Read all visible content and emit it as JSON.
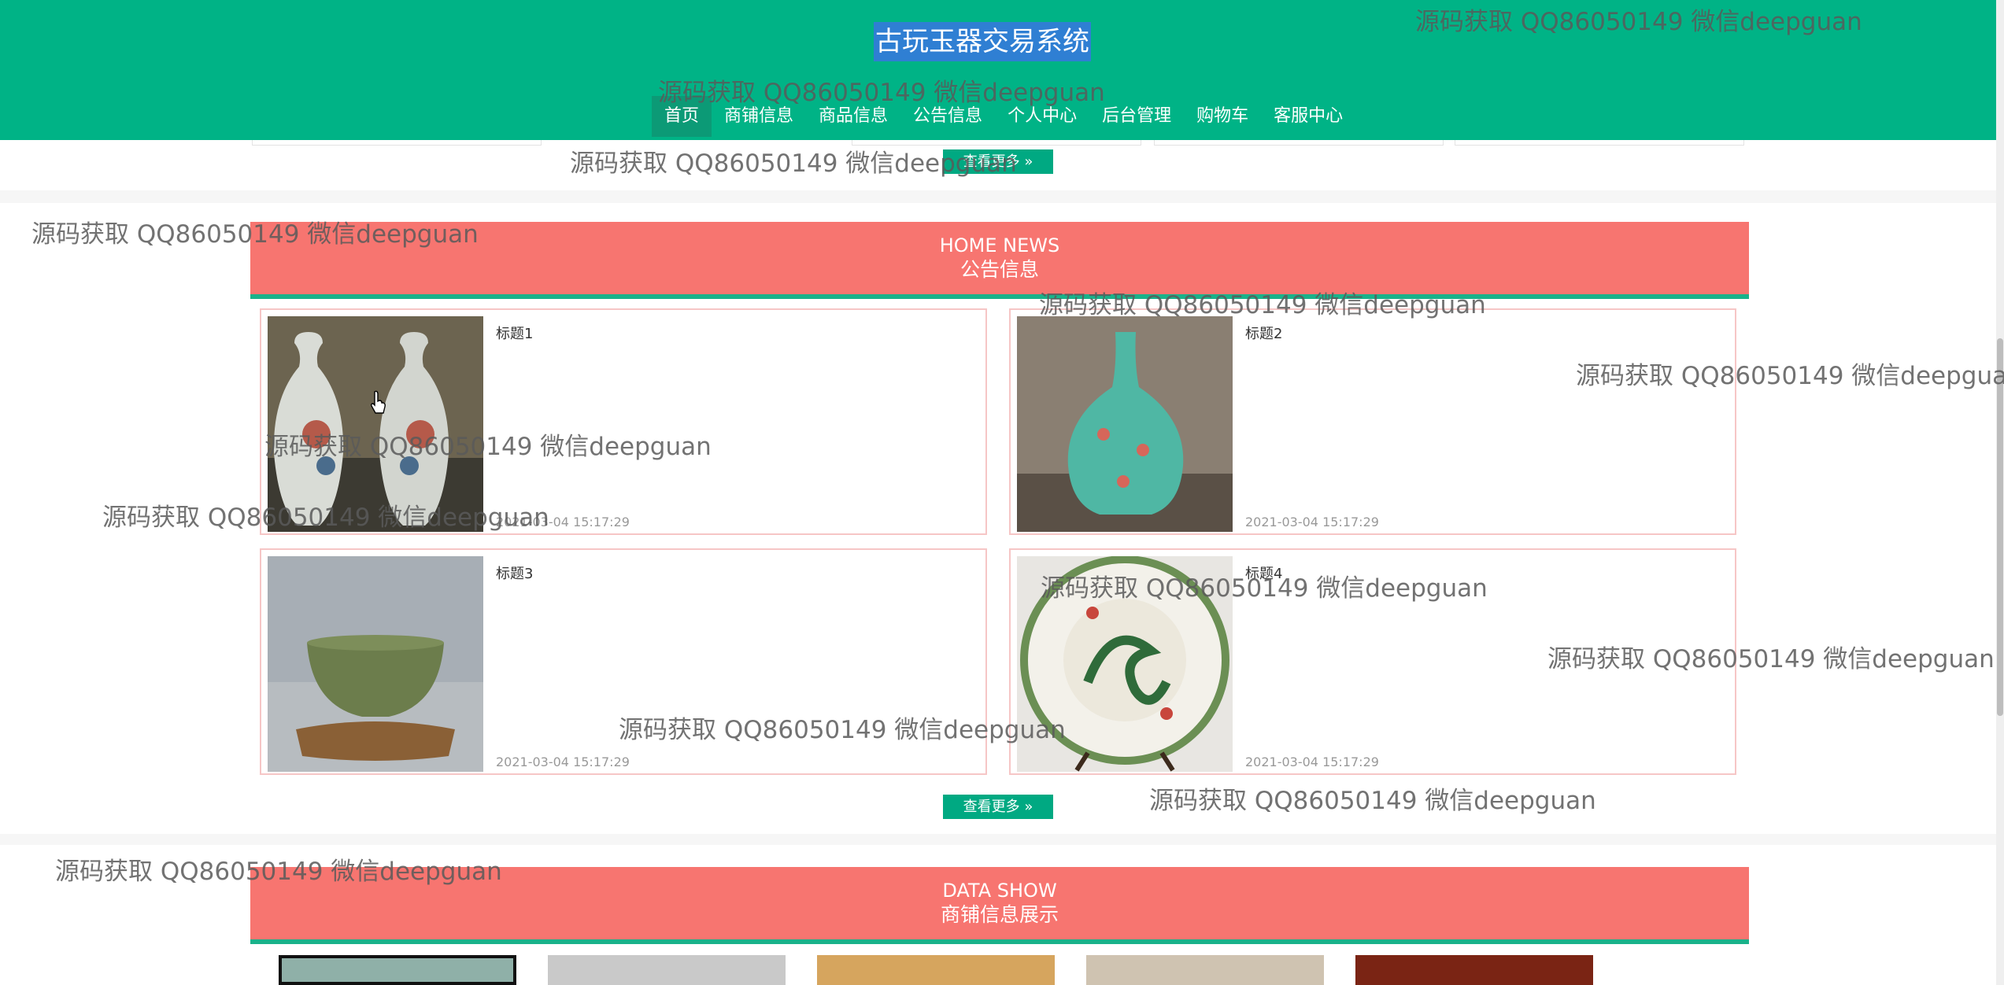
{
  "header": {
    "site_title": "古玩玉器交易系统",
    "nav": [
      "首页",
      "商铺信息",
      "商品信息",
      "公告信息",
      "个人中心",
      "后台管理",
      "购物车",
      "客服中心"
    ]
  },
  "more_label": "查看更多",
  "news_section": {
    "en": "HOME NEWS",
    "cn": "公告信息",
    "items": [
      {
        "title": "标题1",
        "date": "2021-03-04 15:17:29"
      },
      {
        "title": "标题2",
        "date": "2021-03-04 15:17:29"
      },
      {
        "title": "标题3",
        "date": "2021-03-04 15:17:29"
      },
      {
        "title": "标题4",
        "date": "2021-03-04 15:17:29"
      }
    ]
  },
  "data_section": {
    "en": "DATA SHOW",
    "cn": "商铺信息展示"
  },
  "watermark": "源码获取 QQ86050149 微信deepguan",
  "colors": {
    "brand": "#00b386",
    "section_header": "#f77570",
    "button": "#00a982"
  }
}
